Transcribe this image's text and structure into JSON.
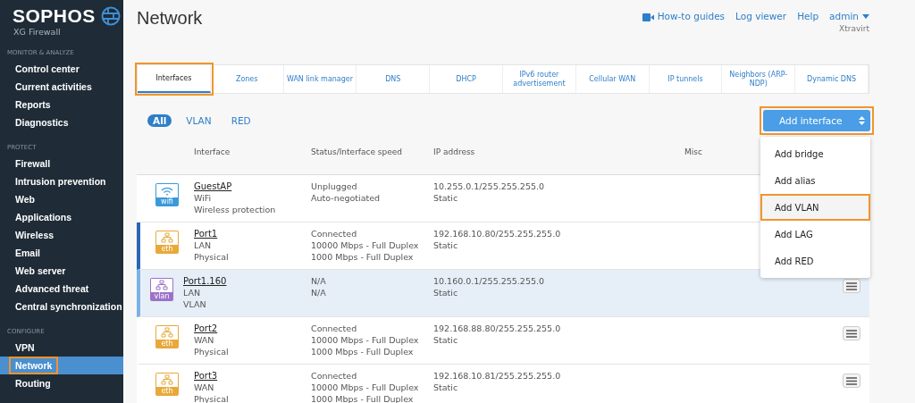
{
  "brand": {
    "name": "SOPHOS",
    "product": "XG Firewall"
  },
  "sidebar": {
    "sections": [
      {
        "label": "MONITOR & ANALYZE",
        "items": [
          {
            "label": "Control center",
            "selected": false,
            "highlighted": false
          },
          {
            "label": "Current activities",
            "selected": false,
            "highlighted": false
          },
          {
            "label": "Reports",
            "selected": false,
            "highlighted": false
          },
          {
            "label": "Diagnostics",
            "selected": false,
            "highlighted": false
          }
        ]
      },
      {
        "label": "PROTECT",
        "items": [
          {
            "label": "Firewall",
            "selected": false,
            "highlighted": false
          },
          {
            "label": "Intrusion prevention",
            "selected": false,
            "highlighted": false
          },
          {
            "label": "Web",
            "selected": false,
            "highlighted": false
          },
          {
            "label": "Applications",
            "selected": false,
            "highlighted": false
          },
          {
            "label": "Wireless",
            "selected": false,
            "highlighted": false
          },
          {
            "label": "Email",
            "selected": false,
            "highlighted": false
          },
          {
            "label": "Web server",
            "selected": false,
            "highlighted": false
          },
          {
            "label": "Advanced threat",
            "selected": false,
            "highlighted": false
          },
          {
            "label": "Central synchronization",
            "selected": false,
            "highlighted": false
          }
        ]
      },
      {
        "label": "CONFIGURE",
        "items": [
          {
            "label": "VPN",
            "selected": false,
            "highlighted": false
          },
          {
            "label": "Network",
            "selected": true,
            "highlighted": true
          },
          {
            "label": "Routing",
            "selected": false,
            "highlighted": false
          }
        ]
      }
    ]
  },
  "page": {
    "title": "Network"
  },
  "top_links": {
    "guides": "How-to guides",
    "log_viewer": "Log viewer",
    "help": "Help",
    "user": "admin",
    "company": "Xtravirt"
  },
  "tabs": [
    {
      "label": "Interfaces",
      "selected": true,
      "highlighted": true
    },
    {
      "label": "Zones",
      "selected": false,
      "highlighted": false
    },
    {
      "label": "WAN link manager",
      "selected": false,
      "highlighted": false
    },
    {
      "label": "DNS",
      "selected": false,
      "highlighted": false
    },
    {
      "label": "DHCP",
      "selected": false,
      "highlighted": false
    },
    {
      "label": "IPv6 router advertisement",
      "selected": false,
      "highlighted": false
    },
    {
      "label": "Cellular WAN",
      "selected": false,
      "highlighted": false
    },
    {
      "label": "IP tunnels",
      "selected": false,
      "highlighted": false
    },
    {
      "label": "Neighbors (ARP-NDP)",
      "selected": false,
      "highlighted": false
    },
    {
      "label": "Dynamic DNS",
      "selected": false,
      "highlighted": false
    }
  ],
  "filters": [
    {
      "label": "All",
      "selected": true
    },
    {
      "label": "VLAN",
      "selected": false
    },
    {
      "label": "RED",
      "selected": false
    }
  ],
  "add_button": {
    "label": "Add interface",
    "highlighted": true
  },
  "add_menu": [
    {
      "label": "Add bridge",
      "highlighted": false
    },
    {
      "label": "Add alias",
      "highlighted": false
    },
    {
      "label": "Add VLAN",
      "highlighted": true
    },
    {
      "label": "Add LAG",
      "highlighted": false
    },
    {
      "label": "Add RED",
      "highlighted": false
    }
  ],
  "table": {
    "columns": [
      "Interface",
      "Status/Interface speed",
      "IP address",
      "Misc"
    ],
    "rows": [
      {
        "kind": "wifi",
        "badge": "wifi",
        "name": "GuestAP",
        "zone": "WiFi",
        "type": "Wireless protection",
        "status": [
          "Unplugged",
          "Auto-negotiated"
        ],
        "ip": "10.255.0.1/255.255.255.0",
        "mode": "Static",
        "selected": false,
        "hovered": false,
        "menu": false
      },
      {
        "kind": "eth",
        "badge": "eth",
        "name": "Port1",
        "zone": "LAN",
        "type": "Physical",
        "status": [
          "Connected",
          "10000 Mbps - Full Duplex",
          "1000 Mbps - Full Duplex"
        ],
        "ip": "192.168.10.80/255.255.255.0",
        "mode": "Static",
        "selected": false,
        "hovered": true,
        "menu": false
      },
      {
        "kind": "vlan",
        "badge": "vlan",
        "name": "Port1.160",
        "zone": "LAN",
        "type": "VLAN",
        "status": [
          "N/A",
          "N/A"
        ],
        "ip": "10.160.0.1/255.255.255.0",
        "mode": "Static",
        "selected": true,
        "hovered": false,
        "menu": true
      },
      {
        "kind": "eth",
        "badge": "eth",
        "name": "Port2",
        "zone": "WAN",
        "type": "Physical",
        "status": [
          "Connected",
          "10000 Mbps - Full Duplex",
          "1000 Mbps - Full Duplex"
        ],
        "ip": "192.168.88.80/255.255.255.0",
        "mode": "Static",
        "selected": false,
        "hovered": false,
        "menu": true
      },
      {
        "kind": "eth",
        "badge": "eth",
        "name": "Port3",
        "zone": "WAN",
        "type": "Physical",
        "status": [
          "Connected",
          "10000 Mbps - Full Duplex",
          "1000 Mbps - Full Duplex"
        ],
        "ip": "192.168.10.81/255.255.255.0",
        "mode": "Static",
        "selected": false,
        "hovered": false,
        "menu": true
      }
    ]
  }
}
